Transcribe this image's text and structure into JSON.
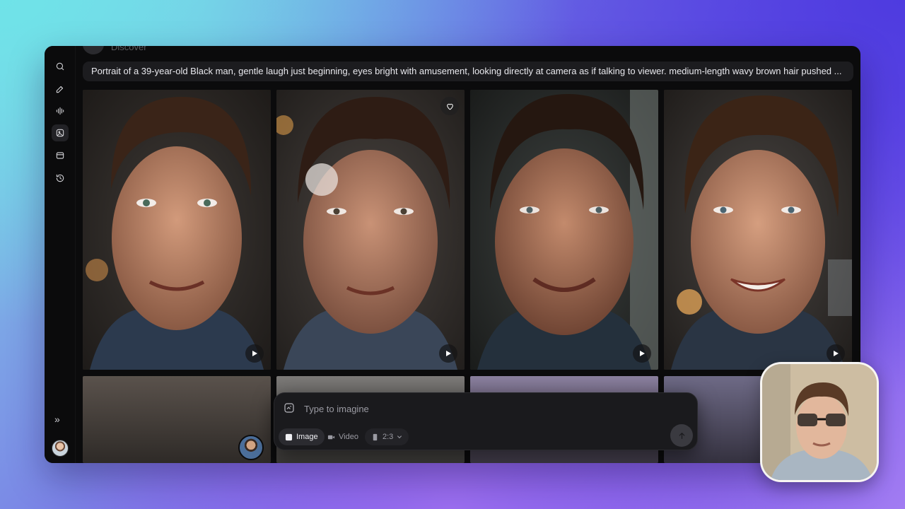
{
  "app": {
    "header_title": "Discover"
  },
  "sidebar": {
    "items": [
      {
        "icon": "search-icon"
      },
      {
        "icon": "edit-icon"
      },
      {
        "icon": "audio-waveform-icon"
      },
      {
        "icon": "images-icon",
        "active": true
      },
      {
        "icon": "folder-icon"
      },
      {
        "icon": "history-icon"
      }
    ],
    "expand_label": "»"
  },
  "prompt": {
    "text": "Portrait of a 39-year-old Black man, gentle laugh just beginning, eyes bright with amusement, looking directly at camera as if talking to viewer. medium-length wavy brown hair pushed ..."
  },
  "composer": {
    "placeholder": "Type to imagine",
    "modes": [
      {
        "label": "Image",
        "icon": "image-icon",
        "selected": true
      },
      {
        "label": "Video",
        "icon": "video-icon",
        "selected": false
      }
    ],
    "aspect_ratio": "2:3"
  },
  "colors": {
    "window_bg": "#0b0b0c",
    "prompt_bg": "#1c1c1f",
    "composer_bg": "#1a1a1d",
    "accent_active": "#2b2b30"
  }
}
